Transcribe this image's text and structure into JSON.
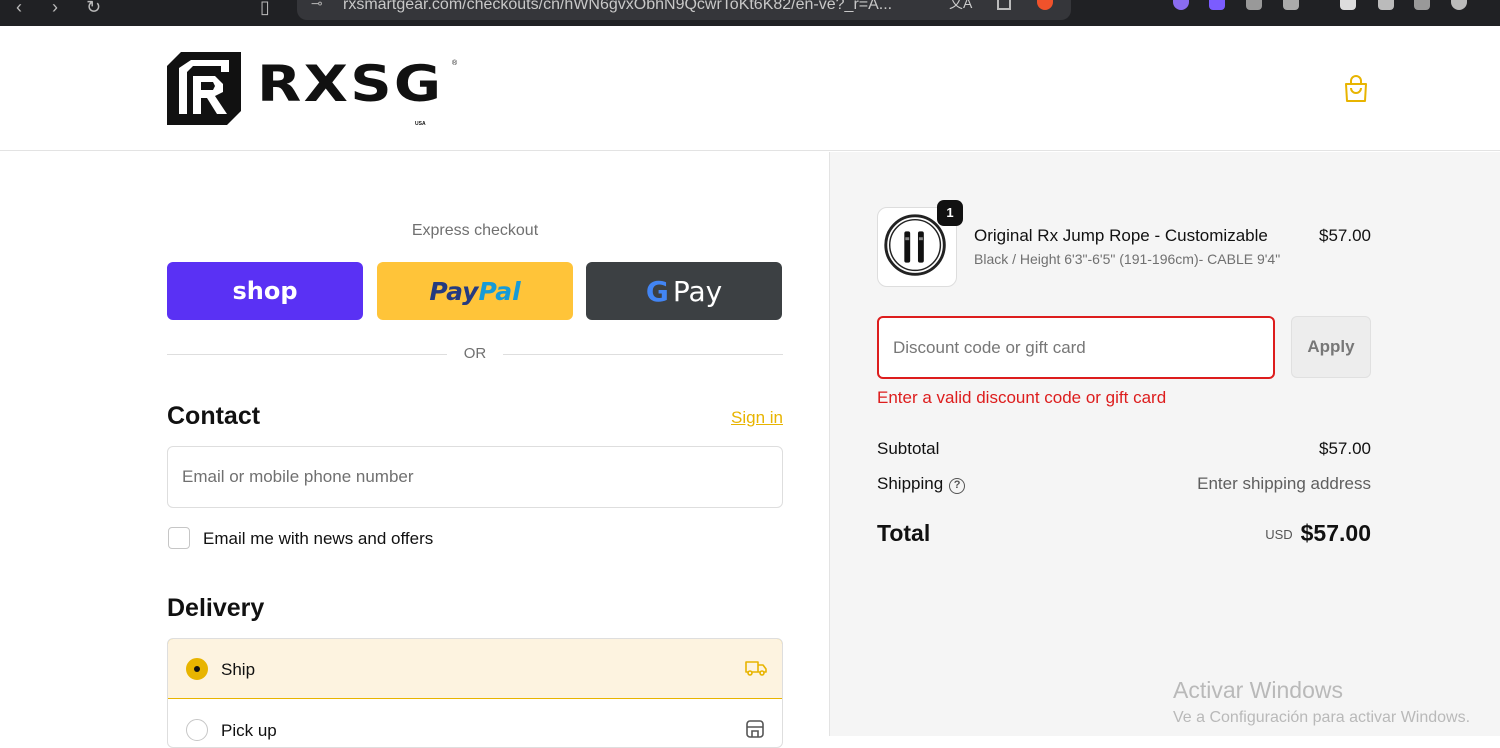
{
  "browser": {
    "url": "rxsmartgear.com/checkouts/cn/hWN6gvxObhN9QcwrToKt6K82/en-ve?_r=A..."
  },
  "header": {
    "logo_text": "RXSG",
    "logo_sub": "USA",
    "logo_reg": "®",
    "cart_icon": "shopping-bag-icon",
    "accent_color": "#e8b400"
  },
  "express": {
    "label": "Express checkout",
    "shop_label": "shop",
    "paypal_part1": "Pay",
    "paypal_part2": "Pal",
    "gpay_g": "G",
    "gpay_label": "Pay",
    "or_text": "OR"
  },
  "contact": {
    "heading": "Contact",
    "signin_label": "Sign in",
    "email_placeholder": "Email or mobile phone number",
    "newsletter_label": "Email me with news and offers"
  },
  "delivery": {
    "heading": "Delivery",
    "options": [
      {
        "label": "Ship",
        "selected": true,
        "icon": "truck-icon"
      },
      {
        "label": "Pick up",
        "selected": false,
        "icon": "store-icon"
      }
    ]
  },
  "summary": {
    "item": {
      "quantity": "1",
      "title": "Original Rx Jump Rope - Customizable",
      "variant": "Black / Height 6'3\"-6'5\" (191-196cm)- CABLE 9'4\"",
      "price": "$57.00"
    },
    "discount_placeholder": "Discount code or gift card",
    "apply_label": "Apply",
    "discount_error": "Enter a valid discount code or gift card",
    "subtotal_label": "Subtotal",
    "subtotal_value": "$57.00",
    "shipping_label": "Shipping",
    "shipping_value": "Enter shipping address",
    "total_label": "Total",
    "total_currency": "USD",
    "total_value": "$57.00",
    "error_color": "#dd1d1d"
  },
  "watermark": {
    "line1": "Activar Windows",
    "line2": "Ve a Configuración para activar Windows."
  }
}
